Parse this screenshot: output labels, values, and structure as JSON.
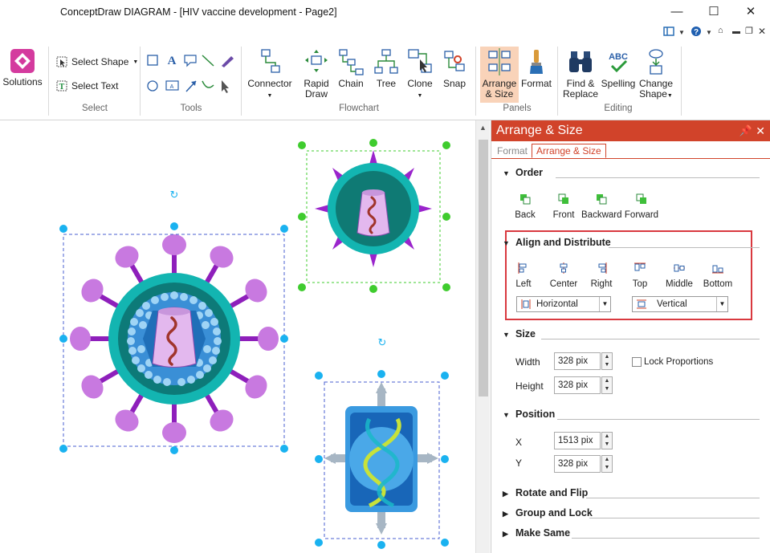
{
  "window": {
    "title": "ConceptDraw DIAGRAM - [HIV vaccine development - Page2]",
    "minimize": "—",
    "maximize": "☐",
    "close": "✕"
  },
  "ribbon": {
    "solutions": "Solutions",
    "select_shape": "Select Shape",
    "select_text": "Select Text",
    "group_select": "Select",
    "group_tools": "Tools",
    "connector": "Connector",
    "rapid_draw_1": "Rapid",
    "rapid_draw_2": "Draw",
    "chain": "Chain",
    "tree": "Tree",
    "clone": "Clone",
    "snap": "Snap",
    "group_flowchart": "Flowchart",
    "arrange_1": "Arrange",
    "arrange_2": "& Size",
    "format": "Format",
    "group_panels": "Panels",
    "find_1": "Find &",
    "find_2": "Replace",
    "spelling": "Spelling",
    "change_1": "Change",
    "change_2": "Shape",
    "group_editing": "Editing"
  },
  "panel": {
    "title": "Arrange & Size",
    "tabs": [
      "Format",
      "Arrange & Size"
    ],
    "order": {
      "heading": "Order",
      "buttons": [
        "Back",
        "Front",
        "Backward",
        "Forward"
      ]
    },
    "align": {
      "heading": "Align and Distribute",
      "buttons": [
        "Left",
        "Center",
        "Right",
        "Top",
        "Middle",
        "Bottom"
      ],
      "horizontal": "Horizontal",
      "vertical": "Vertical"
    },
    "size": {
      "heading": "Size",
      "width_label": "Width",
      "width_value": "328 pix",
      "height_label": "Height",
      "height_value": "328 pix",
      "lock": "Lock Proportions"
    },
    "position": {
      "heading": "Position",
      "x_label": "X",
      "x_value": "1513 pix",
      "y_label": "Y",
      "y_value": "328 pix"
    },
    "collapsed": [
      "Rotate and Flip",
      "Group and Lock",
      "Make Same"
    ]
  },
  "colors": {
    "accent": "#d1432a",
    "virus_teal": "#13b5b1",
    "virus_purple": "#c879e0",
    "selection_blue": "#1ab2f0",
    "selection_green": "#3fcc2e"
  }
}
